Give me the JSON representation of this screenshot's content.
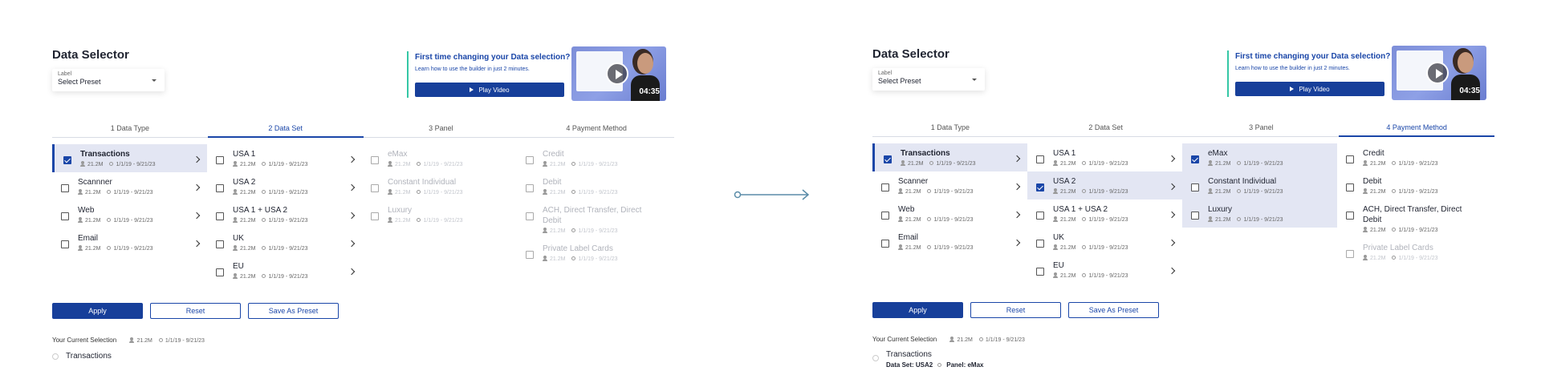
{
  "left": {
    "title": "Data Selector",
    "preset": {
      "label": "Label",
      "value": "Select Preset"
    },
    "promo": {
      "title": "First time changing your Data selection?",
      "subtitle": "Learn how to use the builder in just 2 minutes.",
      "button": "Play Video",
      "duration": "04:35"
    },
    "tabs": [
      "1 Data Type",
      "2 Data Set",
      "3 Panel",
      "4 Payment Method"
    ],
    "columns": [
      [
        {
          "name": "Transactions",
          "count": "21.2M",
          "dates": "1/1/19 - 9/21/23"
        },
        {
          "name": "Scannner",
          "count": "21.2M",
          "dates": "1/1/19 - 9/21/23"
        },
        {
          "name": "Web",
          "count": "21.2M",
          "dates": "1/1/19 - 9/21/23"
        },
        {
          "name": "Email",
          "count": "21.2M",
          "dates": "1/1/19 - 9/21/23"
        }
      ],
      [
        {
          "name": "USA 1",
          "count": "21.2M",
          "dates": "1/1/19 - 9/21/23"
        },
        {
          "name": "USA 2",
          "count": "21.2M",
          "dates": "1/1/19 - 9/21/23"
        },
        {
          "name": "USA 1 + USA 2",
          "count": "21.2M",
          "dates": "1/1/19 - 9/21/23"
        },
        {
          "name": "UK",
          "count": "21.2M",
          "dates": "1/1/19 - 9/21/23"
        },
        {
          "name": "EU",
          "count": "21.2M",
          "dates": "1/1/19 - 9/21/23"
        }
      ],
      [
        {
          "name": "eMax",
          "count": "21.2M",
          "dates": "1/1/19 - 9/21/23"
        },
        {
          "name": "Constant Individual",
          "count": "21.2M",
          "dates": "1/1/19 - 9/21/23"
        },
        {
          "name": "Luxury",
          "count": "21.2M",
          "dates": "1/1/19 - 9/21/23"
        }
      ],
      [
        {
          "name": "Credit",
          "count": "21.2M",
          "dates": "1/1/19 - 9/21/23"
        },
        {
          "name": "Debit",
          "count": "21.2M",
          "dates": "1/1/19 - 9/21/23"
        },
        {
          "name": "ACH, Direct Transfer, Direct Debit",
          "count": "21.2M",
          "dates": "1/1/19 - 9/21/23"
        },
        {
          "name": "Private Label Cards",
          "count": "21.2M",
          "dates": "1/1/19 - 9/21/23"
        }
      ]
    ],
    "buttons": {
      "apply": "Apply",
      "reset": "Reset",
      "save": "Save As Preset"
    },
    "current": {
      "label": "Your Current Selection",
      "count": "21.2M",
      "dates": "1/1/19 - 9/21/23",
      "item": "Transactions"
    }
  },
  "right": {
    "title": "Data Selector",
    "preset": {
      "label": "Label",
      "value": "Select Preset"
    },
    "promo": {
      "title": "First time changing your Data selection?",
      "subtitle": "Learn how to use the builder in just 2 minutes.",
      "button": "Play Video",
      "duration": "04:35"
    },
    "tabs": [
      "1 Data Type",
      "2 Data Set",
      "3 Panel",
      "4 Payment Method"
    ],
    "columns": [
      [
        {
          "name": "Transactions",
          "count": "21.2M",
          "dates": "1/1/19 - 9/21/23"
        },
        {
          "name": "Scanner",
          "count": "21.2M",
          "dates": "1/1/19 - 9/21/23"
        },
        {
          "name": "Web",
          "count": "21.2M",
          "dates": "1/1/19 - 9/21/23"
        },
        {
          "name": "Email",
          "count": "21.2M",
          "dates": "1/1/19 - 9/21/23"
        }
      ],
      [
        {
          "name": "USA 1",
          "count": "21.2M",
          "dates": "1/1/19 - 9/21/23"
        },
        {
          "name": "USA 2",
          "count": "21.2M",
          "dates": "1/1/19 - 9/21/23"
        },
        {
          "name": "USA 1 + USA 2",
          "count": "21.2M",
          "dates": "1/1/19 - 9/21/23"
        },
        {
          "name": "UK",
          "count": "21.2M",
          "dates": "1/1/19 - 9/21/23"
        },
        {
          "name": "EU",
          "count": "21.2M",
          "dates": "1/1/19 - 9/21/23"
        }
      ],
      [
        {
          "name": "eMax",
          "count": "21.2M",
          "dates": "1/1/19 - 9/21/23"
        },
        {
          "name": "Constant Individual",
          "count": "21.2M",
          "dates": "1/1/19 - 9/21/23"
        },
        {
          "name": "Luxury",
          "count": "21.2M",
          "dates": "1/1/19 - 9/21/23"
        }
      ],
      [
        {
          "name": "Credit",
          "count": "21.2M",
          "dates": "1/1/19 - 9/21/23"
        },
        {
          "name": "Debit",
          "count": "21.2M",
          "dates": "1/1/19 - 9/21/23"
        },
        {
          "name": "ACH, Direct Transfer, Direct Debit",
          "count": "21.2M",
          "dates": "1/1/19 - 9/21/23"
        },
        {
          "name": "Private Label Cards",
          "count": "21.2M",
          "dates": "1/1/19 - 9/21/23"
        }
      ]
    ],
    "buttons": {
      "apply": "Apply",
      "reset": "Reset",
      "save": "Save As Preset"
    },
    "current": {
      "label": "Your Current Selection",
      "count": "21.2M",
      "dates": "1/1/19 - 9/21/23",
      "item": "Transactions",
      "detail_set": "Data Set: USA2",
      "detail_panel": "Panel: eMax"
    }
  },
  "colors": {
    "primary": "#173f9a",
    "accent_link": "#1a46a8",
    "selected_bg": "#e3e6f3",
    "promo_bar": "#35c7a5",
    "flow_arrow": "#5a8ca8"
  },
  "icons": [
    "chevron-down-icon",
    "play-icon",
    "person-icon",
    "calendar-icon",
    "chevron-right-icon",
    "checkbox-icon",
    "flow-arrow-icon"
  ]
}
